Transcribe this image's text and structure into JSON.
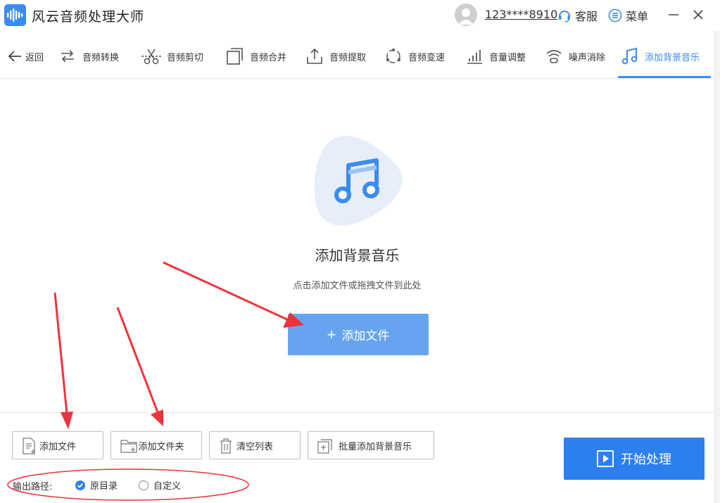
{
  "app": {
    "title": "风云音频处理大师"
  },
  "header": {
    "username": "123****8910",
    "service_label": "客服",
    "menu_label": "菜单"
  },
  "nav": {
    "back_label": "返回",
    "items": [
      {
        "label": "音频转换",
        "icon": "audio-convert-icon"
      },
      {
        "label": "音频剪切",
        "icon": "scissors-icon"
      },
      {
        "label": "音频合并",
        "icon": "merge-icon"
      },
      {
        "label": "音频提取",
        "icon": "upload-icon"
      },
      {
        "label": "音频变速",
        "icon": "speed-icon"
      },
      {
        "label": "音量调整",
        "icon": "volume-bars-icon"
      },
      {
        "label": "噪声消除",
        "icon": "noise-wave-icon"
      },
      {
        "label": "添加背景音乐",
        "icon": "music-note-icon",
        "active": true
      }
    ]
  },
  "drop_area": {
    "title": "添加背景音乐",
    "hint": "点击添加文件或拖拽文件到此处",
    "add_file_label": "添加文件"
  },
  "toolbar": {
    "add_file_label": "添加文件",
    "add_folder_label": "添加文件夹",
    "clear_list_label": "清空列表",
    "batch_add_bgm_label": "批量添加背景音乐"
  },
  "output": {
    "label": "输出路径:",
    "option_original": "原目录",
    "option_custom": "自定义",
    "selected": "原目录"
  },
  "start_label": "开始处理",
  "colors": {
    "accent": "#2d7ff0",
    "accent_light": "#67a4f0",
    "annotation": "#f0323c"
  }
}
